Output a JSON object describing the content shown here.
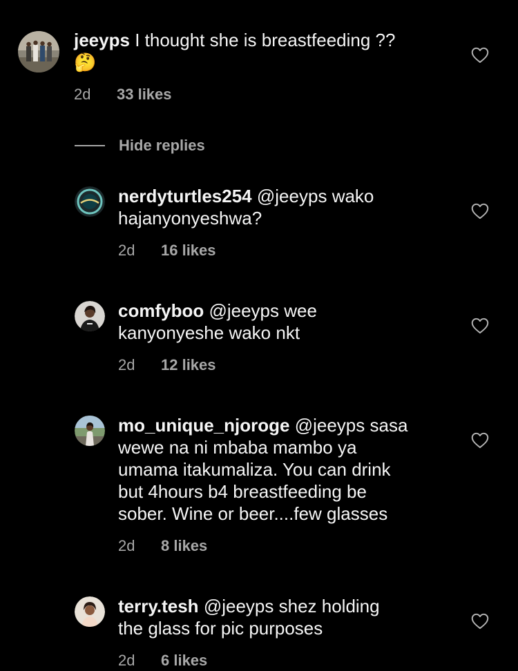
{
  "comments": [
    {
      "username": "jeeyps",
      "mention": "",
      "text": "I thought she is breastfeeding ??",
      "text_lines": [
        "I thought she is breastfeeding ??"
      ],
      "emoji": "🤔",
      "time": "2d",
      "likes": "33 likes",
      "avatar_icon": "group-photo-avatar"
    },
    {
      "username": "nerdyturtles254",
      "mention": "@jeeyps",
      "text_lines": [
        "wako",
        "hajanyonyeshwa?"
      ],
      "time": "2d",
      "likes": "16 likes",
      "avatar_icon": "teal-circle-logo-avatar"
    },
    {
      "username": "comfyboo",
      "mention": "@jeeyps",
      "text_lines": [
        "wee",
        "kanyonyeshe wako nkt"
      ],
      "time": "2d",
      "likes": "12 likes",
      "avatar_icon": "person-dark-avatar"
    },
    {
      "username": "mo_unique_njoroge",
      "mention": "@jeeyps",
      "text_lines": [
        "sasa",
        "wewe na ni mbaba mambo ya",
        "umama itakumaliza.  You can drink",
        "but 4hours b4 breastfeeding be",
        "sober.  Wine or beer....few glasses"
      ],
      "time": "2d",
      "likes": "8 likes",
      "avatar_icon": "person-outdoor-avatar"
    },
    {
      "username": "terry.tesh",
      "mention": "@jeeyps",
      "text_lines": [
        "shez holding",
        "the glass for pic purposes"
      ],
      "time": "2d",
      "likes": "6 likes",
      "avatar_icon": "person-light-avatar"
    }
  ],
  "replies_toggle": {
    "label": "Hide replies"
  },
  "colors": {
    "background": "#000000",
    "text": "#f5f5f5",
    "muted": "#a8a8a8"
  },
  "icons": {
    "like": "heart-outline-icon"
  }
}
